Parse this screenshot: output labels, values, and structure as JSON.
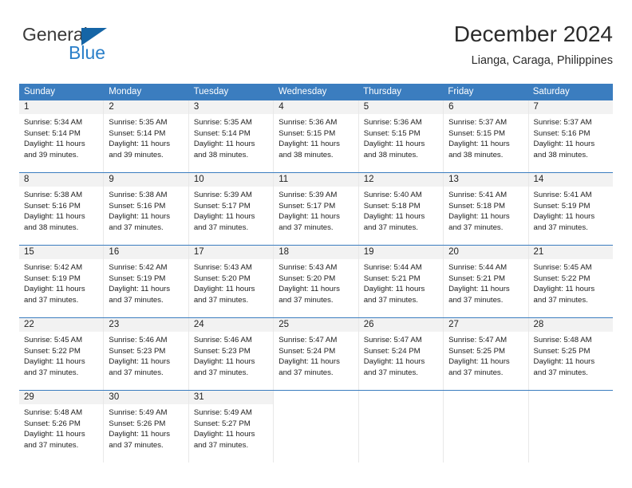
{
  "logo": {
    "primary_text": "General",
    "secondary_text": "Blue",
    "primary_color": "#3a3a3a",
    "secondary_color": "#2a7fc9",
    "triangle_color": "#1565a6"
  },
  "header": {
    "title": "December 2024",
    "subtitle": "Lianga, Caraga, Philippines"
  },
  "theme": {
    "header_row_bg": "#3b7dbf",
    "header_row_text": "#ffffff",
    "day_band_bg": "#f2f2f2",
    "cell_border": "#e8e8e8",
    "week_border": "#3b7dbf"
  },
  "weekdays": [
    "Sunday",
    "Monday",
    "Tuesday",
    "Wednesday",
    "Thursday",
    "Friday",
    "Saturday"
  ],
  "weeks": [
    [
      {
        "day": "1",
        "sunrise": "Sunrise: 5:34 AM",
        "sunset": "Sunset: 5:14 PM",
        "daylight_line1": "Daylight: 11 hours",
        "daylight_line2": "and 39 minutes."
      },
      {
        "day": "2",
        "sunrise": "Sunrise: 5:35 AM",
        "sunset": "Sunset: 5:14 PM",
        "daylight_line1": "Daylight: 11 hours",
        "daylight_line2": "and 39 minutes."
      },
      {
        "day": "3",
        "sunrise": "Sunrise: 5:35 AM",
        "sunset": "Sunset: 5:14 PM",
        "daylight_line1": "Daylight: 11 hours",
        "daylight_line2": "and 38 minutes."
      },
      {
        "day": "4",
        "sunrise": "Sunrise: 5:36 AM",
        "sunset": "Sunset: 5:15 PM",
        "daylight_line1": "Daylight: 11 hours",
        "daylight_line2": "and 38 minutes."
      },
      {
        "day": "5",
        "sunrise": "Sunrise: 5:36 AM",
        "sunset": "Sunset: 5:15 PM",
        "daylight_line1": "Daylight: 11 hours",
        "daylight_line2": "and 38 minutes."
      },
      {
        "day": "6",
        "sunrise": "Sunrise: 5:37 AM",
        "sunset": "Sunset: 5:15 PM",
        "daylight_line1": "Daylight: 11 hours",
        "daylight_line2": "and 38 minutes."
      },
      {
        "day": "7",
        "sunrise": "Sunrise: 5:37 AM",
        "sunset": "Sunset: 5:16 PM",
        "daylight_line1": "Daylight: 11 hours",
        "daylight_line2": "and 38 minutes."
      }
    ],
    [
      {
        "day": "8",
        "sunrise": "Sunrise: 5:38 AM",
        "sunset": "Sunset: 5:16 PM",
        "daylight_line1": "Daylight: 11 hours",
        "daylight_line2": "and 38 minutes."
      },
      {
        "day": "9",
        "sunrise": "Sunrise: 5:38 AM",
        "sunset": "Sunset: 5:16 PM",
        "daylight_line1": "Daylight: 11 hours",
        "daylight_line2": "and 37 minutes."
      },
      {
        "day": "10",
        "sunrise": "Sunrise: 5:39 AM",
        "sunset": "Sunset: 5:17 PM",
        "daylight_line1": "Daylight: 11 hours",
        "daylight_line2": "and 37 minutes."
      },
      {
        "day": "11",
        "sunrise": "Sunrise: 5:39 AM",
        "sunset": "Sunset: 5:17 PM",
        "daylight_line1": "Daylight: 11 hours",
        "daylight_line2": "and 37 minutes."
      },
      {
        "day": "12",
        "sunrise": "Sunrise: 5:40 AM",
        "sunset": "Sunset: 5:18 PM",
        "daylight_line1": "Daylight: 11 hours",
        "daylight_line2": "and 37 minutes."
      },
      {
        "day": "13",
        "sunrise": "Sunrise: 5:41 AM",
        "sunset": "Sunset: 5:18 PM",
        "daylight_line1": "Daylight: 11 hours",
        "daylight_line2": "and 37 minutes."
      },
      {
        "day": "14",
        "sunrise": "Sunrise: 5:41 AM",
        "sunset": "Sunset: 5:19 PM",
        "daylight_line1": "Daylight: 11 hours",
        "daylight_line2": "and 37 minutes."
      }
    ],
    [
      {
        "day": "15",
        "sunrise": "Sunrise: 5:42 AM",
        "sunset": "Sunset: 5:19 PM",
        "daylight_line1": "Daylight: 11 hours",
        "daylight_line2": "and 37 minutes."
      },
      {
        "day": "16",
        "sunrise": "Sunrise: 5:42 AM",
        "sunset": "Sunset: 5:19 PM",
        "daylight_line1": "Daylight: 11 hours",
        "daylight_line2": "and 37 minutes."
      },
      {
        "day": "17",
        "sunrise": "Sunrise: 5:43 AM",
        "sunset": "Sunset: 5:20 PM",
        "daylight_line1": "Daylight: 11 hours",
        "daylight_line2": "and 37 minutes."
      },
      {
        "day": "18",
        "sunrise": "Sunrise: 5:43 AM",
        "sunset": "Sunset: 5:20 PM",
        "daylight_line1": "Daylight: 11 hours",
        "daylight_line2": "and 37 minutes."
      },
      {
        "day": "19",
        "sunrise": "Sunrise: 5:44 AM",
        "sunset": "Sunset: 5:21 PM",
        "daylight_line1": "Daylight: 11 hours",
        "daylight_line2": "and 37 minutes."
      },
      {
        "day": "20",
        "sunrise": "Sunrise: 5:44 AM",
        "sunset": "Sunset: 5:21 PM",
        "daylight_line1": "Daylight: 11 hours",
        "daylight_line2": "and 37 minutes."
      },
      {
        "day": "21",
        "sunrise": "Sunrise: 5:45 AM",
        "sunset": "Sunset: 5:22 PM",
        "daylight_line1": "Daylight: 11 hours",
        "daylight_line2": "and 37 minutes."
      }
    ],
    [
      {
        "day": "22",
        "sunrise": "Sunrise: 5:45 AM",
        "sunset": "Sunset: 5:22 PM",
        "daylight_line1": "Daylight: 11 hours",
        "daylight_line2": "and 37 minutes."
      },
      {
        "day": "23",
        "sunrise": "Sunrise: 5:46 AM",
        "sunset": "Sunset: 5:23 PM",
        "daylight_line1": "Daylight: 11 hours",
        "daylight_line2": "and 37 minutes."
      },
      {
        "day": "24",
        "sunrise": "Sunrise: 5:46 AM",
        "sunset": "Sunset: 5:23 PM",
        "daylight_line1": "Daylight: 11 hours",
        "daylight_line2": "and 37 minutes."
      },
      {
        "day": "25",
        "sunrise": "Sunrise: 5:47 AM",
        "sunset": "Sunset: 5:24 PM",
        "daylight_line1": "Daylight: 11 hours",
        "daylight_line2": "and 37 minutes."
      },
      {
        "day": "26",
        "sunrise": "Sunrise: 5:47 AM",
        "sunset": "Sunset: 5:24 PM",
        "daylight_line1": "Daylight: 11 hours",
        "daylight_line2": "and 37 minutes."
      },
      {
        "day": "27",
        "sunrise": "Sunrise: 5:47 AM",
        "sunset": "Sunset: 5:25 PM",
        "daylight_line1": "Daylight: 11 hours",
        "daylight_line2": "and 37 minutes."
      },
      {
        "day": "28",
        "sunrise": "Sunrise: 5:48 AM",
        "sunset": "Sunset: 5:25 PM",
        "daylight_line1": "Daylight: 11 hours",
        "daylight_line2": "and 37 minutes."
      }
    ],
    [
      {
        "day": "29",
        "sunrise": "Sunrise: 5:48 AM",
        "sunset": "Sunset: 5:26 PM",
        "daylight_line1": "Daylight: 11 hours",
        "daylight_line2": "and 37 minutes."
      },
      {
        "day": "30",
        "sunrise": "Sunrise: 5:49 AM",
        "sunset": "Sunset: 5:26 PM",
        "daylight_line1": "Daylight: 11 hours",
        "daylight_line2": "and 37 minutes."
      },
      {
        "day": "31",
        "sunrise": "Sunrise: 5:49 AM",
        "sunset": "Sunset: 5:27 PM",
        "daylight_line1": "Daylight: 11 hours",
        "daylight_line2": "and 37 minutes."
      },
      {
        "day": "",
        "sunrise": "",
        "sunset": "",
        "daylight_line1": "",
        "daylight_line2": ""
      },
      {
        "day": "",
        "sunrise": "",
        "sunset": "",
        "daylight_line1": "",
        "daylight_line2": ""
      },
      {
        "day": "",
        "sunrise": "",
        "sunset": "",
        "daylight_line1": "",
        "daylight_line2": ""
      },
      {
        "day": "",
        "sunrise": "",
        "sunset": "",
        "daylight_line1": "",
        "daylight_line2": ""
      }
    ]
  ]
}
